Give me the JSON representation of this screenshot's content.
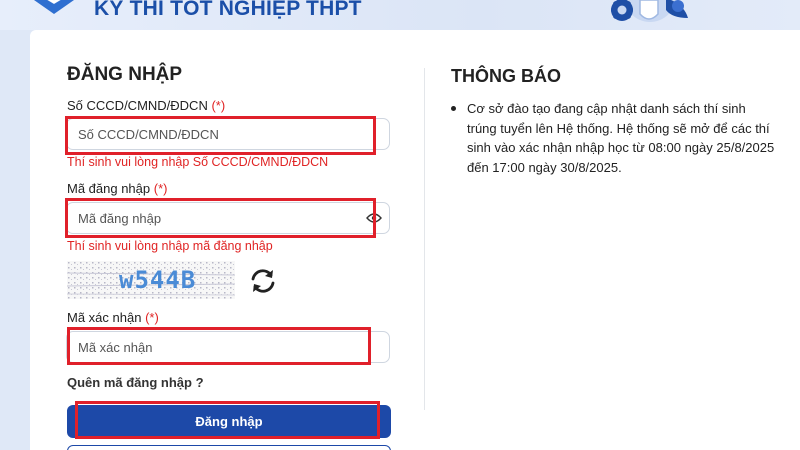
{
  "header": {
    "site_title": "KỲ THI TỐT NGHIỆP THPT"
  },
  "login": {
    "title": "ĐĂNG NHẬP",
    "required_mark": "(*)",
    "id_field": {
      "label": "Số CCCD/CMND/ĐDCN",
      "placeholder": "Số CCCD/CMND/ĐDCN",
      "error": "Thí sinh vui lòng nhập Số CCCD/CMND/ĐDCN"
    },
    "password_field": {
      "label": "Mã đăng nhập",
      "placeholder": "Mã đăng nhập",
      "error": "Thí sinh vui lòng nhập mã đăng nhập"
    },
    "captcha": {
      "text": "w544B"
    },
    "captcha_field": {
      "label": "Mã xác nhận",
      "placeholder": "Mã xác nhận"
    },
    "forgot_label": "Quên mã đăng nhập ?",
    "submit_label": "Đăng nhập"
  },
  "notice": {
    "title": "THÔNG BÁO",
    "items": [
      "Cơ sở đào tạo đang cập nhật danh sách thí sinh trúng tuyển lên Hệ thống. Hệ thống sẽ mở để các thí sinh vào xác nhận nhập học từ 08:00 ngày 25/8/2025 đến 17:00 ngày 30/8/2025."
    ]
  },
  "colors": {
    "primary": "#1d49a8",
    "error": "#e02424",
    "highlight": "#e0202a",
    "captcha_text": "#4a8bd6"
  },
  "icons": {
    "logo": "book-logo-icon",
    "password_toggle": "eye-icon",
    "captcha_refresh": "refresh-icon",
    "header_art": "lightbulb-gear-icon"
  }
}
